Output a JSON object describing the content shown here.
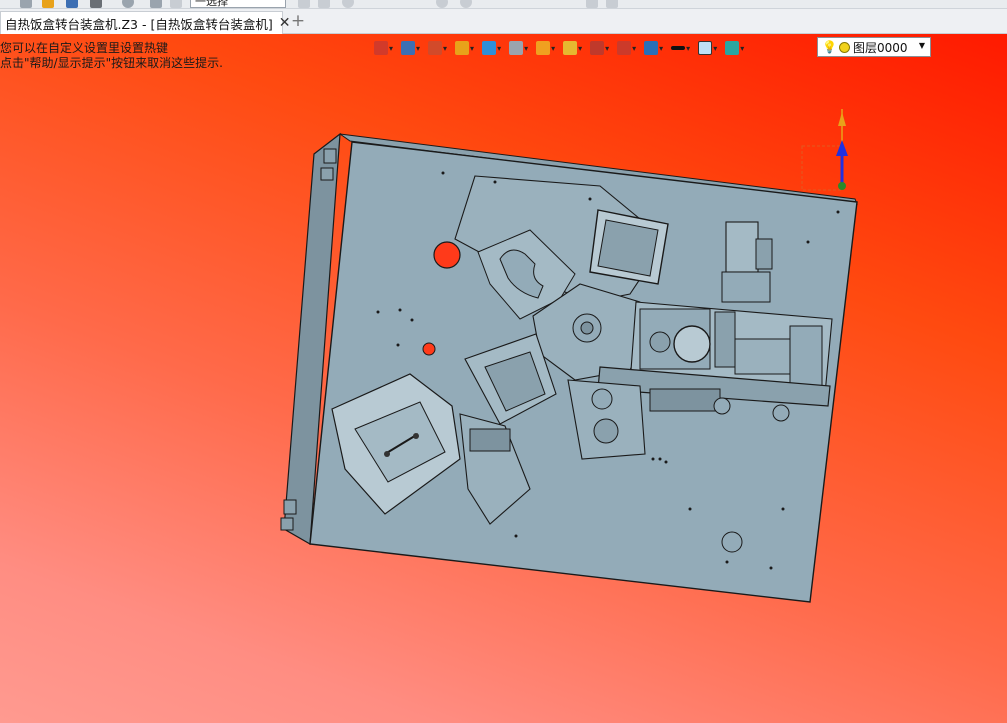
{
  "quick_access": {
    "combo_value": "一选择"
  },
  "tabs": [
    {
      "label": "自热饭盒转台装盒机.Z3 - [自热饭盒转台装盒机]",
      "active": true
    }
  ],
  "new_tab_label": "+",
  "close_glyph": "✕",
  "viewport": {
    "hints": [
      "您可以在自定义设置里设置热键",
      "点击\"帮助/显示提示\"按钮来取消这些提示."
    ],
    "toolbar": {
      "items": [
        {
          "icon": "pick-filter-icon",
          "color": "#d23a2a"
        },
        {
          "icon": "render-mode-icon",
          "color": "#3d6fb3"
        },
        {
          "icon": "brush-icon",
          "color": "#d24a2a"
        },
        {
          "icon": "shaded-box-icon",
          "color": "#e8a21a"
        },
        {
          "icon": "view-cube-icon",
          "color": "#2f8fd8"
        },
        {
          "icon": "iso-view-icon",
          "color": "#9aa4ae"
        },
        {
          "icon": "section-view-icon",
          "color": "#f0a020"
        },
        {
          "icon": "zoom-icon",
          "color": "#e6b830"
        },
        {
          "icon": "fit-view-icon",
          "color": "#c0392b"
        },
        {
          "icon": "dimension-icon",
          "color": "#cc3a2a"
        },
        {
          "icon": "display-settings-icon",
          "color": "#2a6fb8"
        },
        {
          "icon": "line-color-icon",
          "color": "#111111"
        },
        {
          "icon": "face-color-icon",
          "color": "#bfe0f5"
        },
        {
          "icon": "layer-manager-icon",
          "color": "#2aa6a0"
        }
      ],
      "layer_value": "图层0000"
    }
  },
  "colors": {
    "bg_top": "#ff1a00",
    "bg_bottom": "#ff9a90",
    "part_fill": "#93abb8",
    "part_edge": "#1a1a1a",
    "axis_z": "#e8a21a",
    "axis_blue": "#2030e0"
  }
}
